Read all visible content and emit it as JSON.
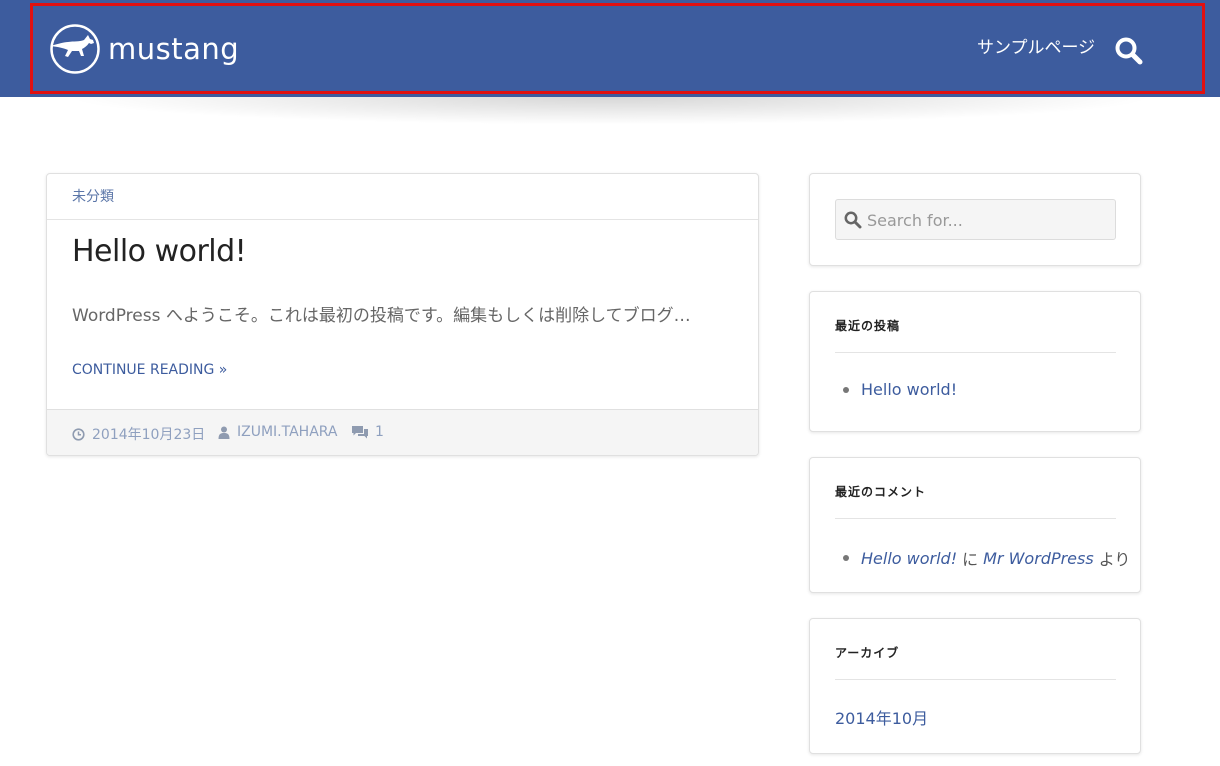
{
  "header": {
    "brand": "mustang",
    "nav": [
      {
        "label": "サンプルページ"
      }
    ],
    "highlight_color": "#e01010",
    "background_color": "#3d5c9e"
  },
  "icons": {
    "logo": "mustang-horse-logo",
    "search": "search-icon",
    "date": "clock-icon",
    "author": "user-icon",
    "comments": "comments-icon"
  },
  "post": {
    "category": "未分類",
    "title": "Hello world!",
    "excerpt": "WordPress へようこそ。これは最初の投稿です。編集もしくは削除してブログ…",
    "continue_label": "CONTINUE READING »",
    "date": "2014年10月23日",
    "author": "IZUMI.TAHARA",
    "comment_count": "1"
  },
  "sidebar": {
    "search": {
      "placeholder": "Search for..."
    },
    "recent_posts": {
      "title": "最近の投稿",
      "items": [
        {
          "label": "Hello world!"
        }
      ]
    },
    "recent_comments": {
      "title": "最近のコメント",
      "items": [
        {
          "post": "Hello world!",
          "connector": "に",
          "author": "Mr WordPress",
          "suffix": "より"
        }
      ]
    },
    "archives": {
      "title": "アーカイブ",
      "items": [
        {
          "label": "2014年10月"
        }
      ]
    }
  }
}
